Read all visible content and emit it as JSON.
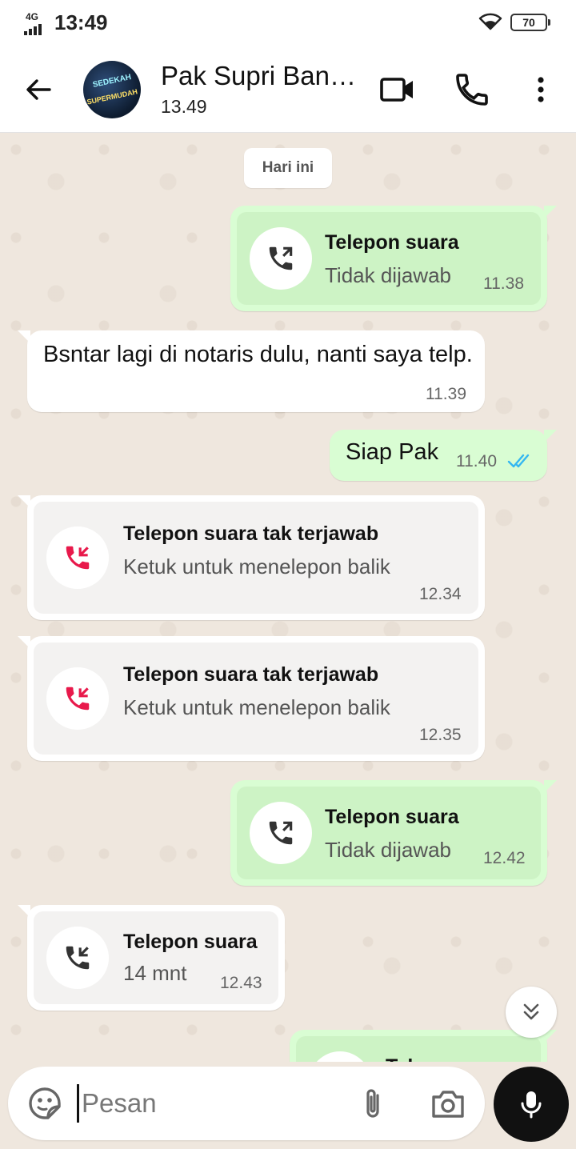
{
  "status_bar": {
    "network": "4G",
    "time": "13:49",
    "battery": "70"
  },
  "header": {
    "contact_name": "Pak Supri Ban…",
    "subtitle": "13.49",
    "avatar_text_1": "SEDEKAH",
    "avatar_text_2": "SUPERMUDAH"
  },
  "chat": {
    "date_chip": "Hari ini",
    "messages": [
      {
        "direction": "outgoing",
        "kind": "voice-call",
        "title": "Telepon suara",
        "subtitle": "Tidak dijawab",
        "time": "11.38"
      },
      {
        "direction": "incoming",
        "kind": "text",
        "text": "Bsntar lagi di notaris dulu, nanti saya telp.",
        "time": "11.39"
      },
      {
        "direction": "outgoing",
        "kind": "text",
        "text": "Siap Pak",
        "time": "11.40",
        "read": true
      },
      {
        "direction": "incoming",
        "kind": "missed-call",
        "title": "Telepon suara tak terjawab",
        "subtitle": "Ketuk untuk menelepon balik",
        "time": "12.34"
      },
      {
        "direction": "incoming",
        "kind": "missed-call",
        "title": "Telepon suara tak terjawab",
        "subtitle": "Ketuk untuk menelepon balik",
        "time": "12.35"
      },
      {
        "direction": "outgoing",
        "kind": "voice-call",
        "title": "Telepon suara",
        "subtitle": "Tidak dijawab",
        "time": "12.42"
      },
      {
        "direction": "incoming",
        "kind": "voice-call",
        "title": "Telepon suara",
        "subtitle": "14 mnt",
        "time": "12.43"
      },
      {
        "direction": "outgoing",
        "kind": "voice-call",
        "title": "Tel",
        "partial": true
      }
    ]
  },
  "composer": {
    "placeholder": "Pesan"
  },
  "colors": {
    "outgoing_bubble": "#d9fdd3",
    "incoming_bubble": "#ffffff",
    "missed_call": "#e8194b",
    "read_ticks": "#34b7f1",
    "mic_button": "#111111"
  },
  "icons": [
    "back-arrow-icon",
    "video-call-icon",
    "phone-icon",
    "more-vert-icon",
    "outgoing-call-icon",
    "missed-call-icon",
    "incoming-call-icon",
    "double-check-icon",
    "chevron-double-down-icon",
    "sticker-icon",
    "paperclip-icon",
    "camera-icon",
    "mic-icon"
  ]
}
